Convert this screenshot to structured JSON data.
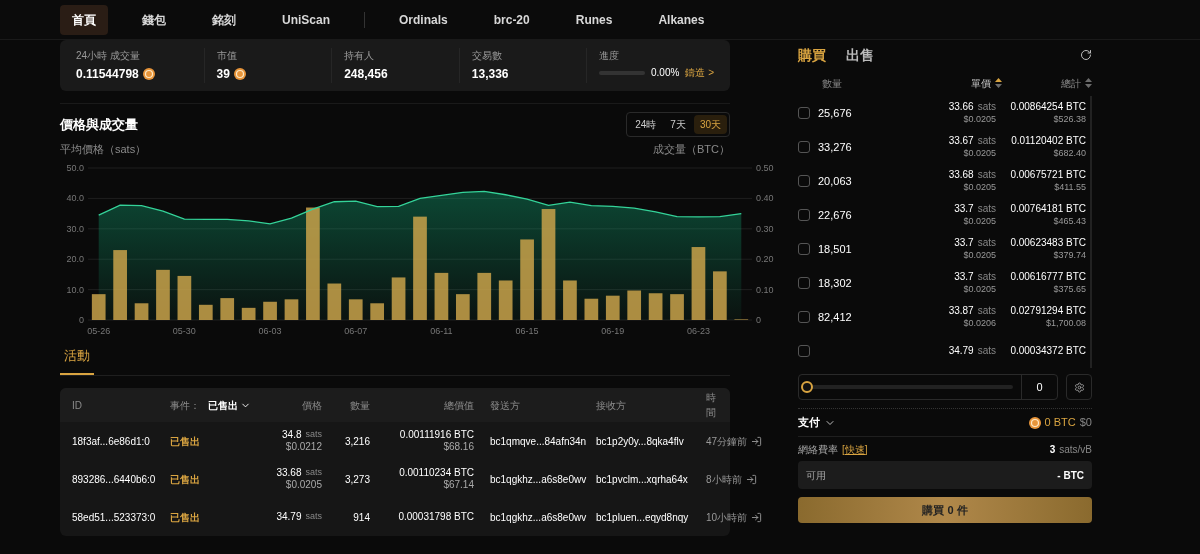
{
  "nav": {
    "primary": [
      {
        "label": "首頁",
        "selected": true
      },
      {
        "label": "錢包",
        "selected": false
      },
      {
        "label": "銘刻",
        "selected": false
      },
      {
        "label": "UniScan",
        "selected": false
      }
    ],
    "protocols": [
      {
        "label": "Ordinals",
        "selected": false
      },
      {
        "label": "brc-20",
        "selected": false
      },
      {
        "label": "Runes",
        "selected": false
      },
      {
        "label": "Alkanes",
        "selected": false
      }
    ]
  },
  "stats": [
    {
      "label": "24小時 成交量",
      "value": "0.11544798",
      "coin": true
    },
    {
      "label": "市值",
      "value": "39",
      "coin": true
    },
    {
      "label": "持有人",
      "value": "248,456",
      "coin": false
    },
    {
      "label": "交易數",
      "value": "13,336",
      "coin": false
    }
  ],
  "progress": {
    "label": "進度",
    "level": 0,
    "reading": "0.00%",
    "link": "鑄造 >"
  },
  "price_chart": {
    "title": "價格與成交量",
    "ranges": [
      {
        "label": "24時",
        "selected": false
      },
      {
        "label": "7天",
        "selected": false
      },
      {
        "label": "30天",
        "selected": true
      }
    ],
    "chart_data": {
      "type": "bar",
      "ylabel": "平均價格（sats）",
      "y2label": "成交量（BTC）",
      "categories": [
        "05-26",
        null,
        null,
        null,
        "05-30",
        null,
        null,
        null,
        "06-03",
        null,
        null,
        null,
        "06-07",
        null,
        null,
        null,
        "06-11",
        null,
        null,
        null,
        "06-15",
        null,
        null,
        null,
        "06-19",
        null,
        null,
        null,
        "06-23",
        null,
        null
      ],
      "series": [
        {
          "type": "bar",
          "axis": "y2",
          "color": "#c9a24a",
          "values": [
            0.085,
            0.23,
            0.055,
            0.165,
            0.145,
            0.05,
            0.072,
            0.04,
            0.06,
            0.068,
            0.37,
            0.12,
            0.068,
            0.055,
            0.14,
            0.34,
            0.155,
            0.085,
            0.155,
            0.13,
            0.265,
            0.365,
            0.13,
            0.07,
            0.08,
            0.097,
            0.088,
            0.085,
            0.24,
            0.16,
            0.002
          ]
        },
        {
          "type": "area",
          "color": "#34d399",
          "values": [
            34.5,
            37.8,
            37.6,
            35.8,
            33.2,
            33.1,
            33.1,
            32.6,
            31.6,
            33.5,
            36.5,
            38.9,
            39.1,
            37.3,
            37.4,
            40.0,
            41.0,
            42.0,
            42.3,
            41.2,
            39.8,
            37.7,
            38.8,
            37.6,
            37.4,
            36.8,
            35.6,
            34.0,
            33.9,
            34.0,
            35.0
          ]
        }
      ],
      "yticks": [
        {
          "value": 0,
          "label": "0"
        },
        {
          "value": 10,
          "label": "10.0"
        },
        {
          "value": 20,
          "label": "20.0"
        },
        {
          "value": 30,
          "label": "30.0"
        },
        {
          "value": 40,
          "label": "40.0"
        },
        {
          "value": 50,
          "label": "50.0"
        }
      ],
      "y2ticks": [
        {
          "value": 0,
          "label": "0"
        },
        {
          "value": 0.1,
          "label": "0.10"
        },
        {
          "value": 0.2,
          "label": "0.20"
        },
        {
          "value": 0.3,
          "label": "0.30"
        },
        {
          "value": 0.4,
          "label": "0.40"
        },
        {
          "value": 0.5,
          "label": "0.50"
        }
      ],
      "grid": true,
      "ylim": [
        0,
        50
      ],
      "y2lim": [
        0,
        0.5
      ]
    }
  },
  "activity": {
    "tabs": [
      {
        "label": "活動",
        "selected": true
      }
    ],
    "columns": {
      "id": "ID",
      "event": "事件：",
      "filter": "已售出",
      "price": "價格",
      "qty": "數量",
      "total": "總價值",
      "from": "發送方",
      "to": "接收方",
      "time": "時間"
    },
    "rows": [
      {
        "id": "18f3af...6e86d1:0",
        "event": "已售出",
        "price": "34.8",
        "unit": "sats",
        "usd": "$0.0212",
        "qty": "3,216",
        "total": "0.00111916 BTC",
        "total_usd": "$68.16",
        "from": "bc1qmqve...84afn34n",
        "to": "bc1p2y0y...8qka4flv",
        "time": "47分鐘前"
      },
      {
        "id": "893286...6440b6:0",
        "event": "已售出",
        "price": "33.68",
        "unit": "sats",
        "usd": "$0.0205",
        "qty": "3,273",
        "total": "0.00110234 BTC",
        "total_usd": "$67.14",
        "from": "bc1qgkhz...a6s8e0wv",
        "to": "bc1pvclm...xqrha64x",
        "time": "8小時前"
      },
      {
        "id": "58ed51...523373:0",
        "event": "已售出",
        "price": "34.79",
        "unit": "sats",
        "qty": "914",
        "total": "0.00031798 BTC",
        "from": "bc1qgkhz...a6s8e0wv",
        "to": "bc1pluen...eqyd8nqy",
        "time": "10小時前"
      }
    ]
  },
  "trade": {
    "tabs": [
      {
        "label": "購買",
        "selected": true
      },
      {
        "label": "出售",
        "selected": false
      }
    ],
    "columns": [
      {
        "label": "數量",
        "sortable": false
      },
      {
        "label": "單價",
        "sorted": true,
        "sortable": true
      },
      {
        "label": "總計",
        "sorted": false,
        "sortable": true
      }
    ],
    "orders": [
      {
        "checked": false,
        "qty": "25,676",
        "price": "33.66",
        "unit": "sats",
        "usd": "$0.0205",
        "total": "0.00864254 BTC",
        "total_usd": "$526.38"
      },
      {
        "checked": false,
        "qty": "33,276",
        "price": "33.67",
        "unit": "sats",
        "usd": "$0.0205",
        "total": "0.01120402 BTC",
        "total_usd": "$682.40"
      },
      {
        "checked": false,
        "qty": "20,063",
        "price": "33.68",
        "unit": "sats",
        "usd": "$0.0205",
        "total": "0.00675721 BTC",
        "total_usd": "$411.55"
      },
      {
        "checked": false,
        "qty": "22,676",
        "price": "33.7",
        "unit": "sats",
        "usd": "$0.0205",
        "total": "0.00764181 BTC",
        "total_usd": "$465.43"
      },
      {
        "checked": false,
        "qty": "18,501",
        "price": "33.7",
        "unit": "sats",
        "usd": "$0.0205",
        "total": "0.00623483 BTC",
        "total_usd": "$379.74"
      },
      {
        "checked": false,
        "qty": "18,302",
        "price": "33.7",
        "unit": "sats",
        "usd": "$0.0205",
        "total": "0.00616777 BTC",
        "total_usd": "$375.65"
      },
      {
        "checked": false,
        "qty": "82,412",
        "price": "33.87",
        "unit": "sats",
        "usd": "$0.0206",
        "total": "0.02791294 BTC",
        "total_usd": "$1,700.08"
      },
      {
        "checked": false,
        "price": "34.79",
        "unit": "sats",
        "total": "0.00034372 BTC"
      }
    ],
    "slider": {
      "level": 0,
      "value": "0"
    },
    "pay": {
      "label": "支付",
      "btc": "0 BTC",
      "usd": "$0"
    },
    "fee": {
      "label": "網絡費率",
      "mode": "[快速]",
      "value": "3",
      "unit": "sats/vB"
    },
    "available": {
      "label": "可用",
      "value": "- BTC"
    },
    "buy_button": "購買 0 件"
  }
}
